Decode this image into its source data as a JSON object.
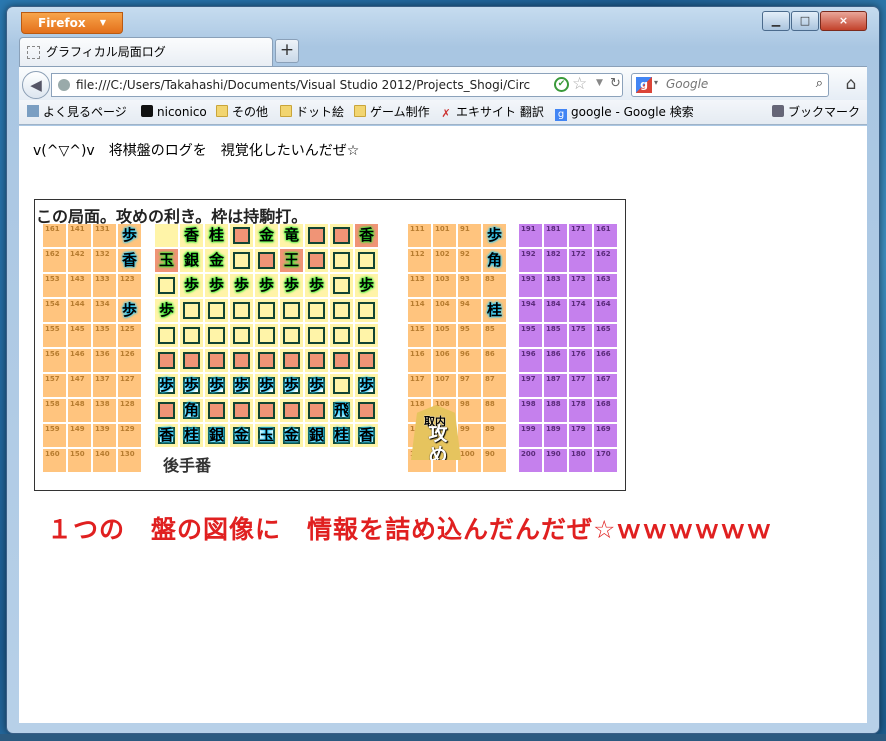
{
  "window": {
    "app_button": "Firefox",
    "tab_title": "グラフィカル局面ログ",
    "tab_close": "×",
    "new_tab": "+",
    "min": "▁",
    "max": "□",
    "close": "×"
  },
  "nav": {
    "url": "file:///C:/Users/Takahashi/Documents/Visual Studio 2012/Projects_Shogi/Circ",
    "search_placeholder": "Google",
    "search_engine_icon": "google-icon"
  },
  "bookmarks": [
    {
      "label": "よく見るページ",
      "icon": "most-visited-icon"
    },
    {
      "label": "niconico",
      "icon": "niconico-icon"
    },
    {
      "label": "その他",
      "icon": "folder-icon"
    },
    {
      "label": "ドット絵",
      "icon": "folder-icon"
    },
    {
      "label": "ゲーム制作",
      "icon": "folder-icon"
    },
    {
      "label": "エキサイト 翻訳",
      "icon": "excite-icon"
    },
    {
      "label": "google - Google 検索",
      "icon": "google-icon"
    },
    {
      "label": "ブックマーク",
      "icon": "bookmarks-icon"
    }
  ],
  "page": {
    "heading": "v(^▽^)v　将棋盤のログを　視覚化したいんだぜ☆",
    "panel_title": "この局面。攻めの利き。枠は持駒打。",
    "gote_label": "後手番",
    "attack_top": "取内",
    "attack_main": "攻め",
    "message": "１つの　盤の図像に　情報を詰め込んだんだぜ☆ｗｗｗｗｗｗ"
  },
  "board": {
    "left_cols": [
      [
        "161",
        "162",
        "153",
        "154",
        "155",
        "156",
        "157",
        "158",
        "159",
        "160"
      ],
      [
        "141",
        "142",
        "143",
        "144",
        "145",
        "146",
        "147",
        "148",
        "149",
        "150"
      ],
      [
        "131",
        "132",
        "133",
        "134",
        "135",
        "136",
        "137",
        "138",
        "139",
        "140"
      ],
      [
        "121",
        "122",
        "123",
        "124",
        "125",
        "126",
        "127",
        "128",
        "129",
        "130"
      ]
    ],
    "left_pieces": [
      {
        "col": 3,
        "row": 0,
        "p": "歩",
        "up": true
      },
      {
        "col": 3,
        "row": 1,
        "p": "香",
        "up": true
      },
      {
        "col": 3,
        "row": 3,
        "p": "歩",
        "up": true
      }
    ],
    "mid_cols": [
      [
        "111",
        "112",
        "113",
        "114",
        "115",
        "116",
        "117",
        "118",
        "119",
        "120"
      ],
      [
        "101",
        "102",
        "103",
        "104",
        "105",
        "106",
        "107",
        "108",
        "109",
        "110"
      ],
      [
        "91",
        "92",
        "93",
        "94",
        "95",
        "96",
        "97",
        "98",
        "99",
        "100"
      ],
      [
        "81",
        "82",
        "83",
        "84",
        "85",
        "86",
        "87",
        "88",
        "89",
        "90"
      ]
    ],
    "mid_pieces": [
      {
        "col": 3,
        "row": 0,
        "p": "歩"
      },
      {
        "col": 3,
        "row": 1,
        "p": "角"
      },
      {
        "col": 3,
        "row": 3,
        "p": "桂"
      }
    ],
    "right_cols": [
      [
        "191",
        "192",
        "193",
        "194",
        "195",
        "196",
        "197",
        "198",
        "199",
        "200"
      ],
      [
        "181",
        "182",
        "183",
        "184",
        "185",
        "186",
        "187",
        "188",
        "189",
        "190"
      ],
      [
        "171",
        "172",
        "173",
        "174",
        "175",
        "176",
        "177",
        "178",
        "179",
        "180"
      ],
      [
        "161",
        "162",
        "163",
        "164",
        "165",
        "166",
        "167",
        "168",
        "169",
        "170"
      ]
    ],
    "main": [
      [
        "_",
        "g:香",
        "g:桂",
        "s:",
        "g:金",
        "g:竜",
        "s:",
        "s:",
        "s:香"
      ],
      [
        "s:玉",
        "g:銀",
        "g:金",
        "e:",
        "s:",
        "s:王",
        "s:",
        "e:",
        "e:"
      ],
      [
        "e:",
        "g:歩",
        "g:歩",
        "g:歩",
        "g:歩",
        "g:歩",
        "g:歩",
        "e:",
        "g:歩"
      ],
      [
        "g:歩",
        "e:",
        "e:",
        "e:",
        "e:",
        "e:",
        "e:",
        "e:",
        "e:"
      ],
      [
        "e:",
        "e:",
        "e:",
        "e:",
        "e:",
        "e:",
        "e:",
        "e:",
        "e:"
      ],
      [
        "s:",
        "s:",
        "s:",
        "s:",
        "s:",
        "s:",
        "s:",
        "s:",
        "s:"
      ],
      [
        "c:歩",
        "c:歩",
        "c:歩",
        "c:歩",
        "c:歩",
        "c:歩",
        "c:歩",
        "e:",
        "c:歩"
      ],
      [
        "s:",
        "c:角",
        "s:",
        "s:",
        "s:",
        "s:",
        "s:",
        "c:飛",
        "s:"
      ],
      [
        "c:香",
        "c:桂",
        "c:銀",
        "c:金",
        "c:玉",
        "c:金",
        "c:銀",
        "c:桂",
        "c:香"
      ]
    ]
  },
  "colors": {
    "hand_cell": "#ffc47e",
    "purple_cell": "#c580ed",
    "board_bg": "#fff4a8",
    "attack_green": "#8fe29a",
    "salmon": "#f09476",
    "message_red": "#e02020"
  }
}
